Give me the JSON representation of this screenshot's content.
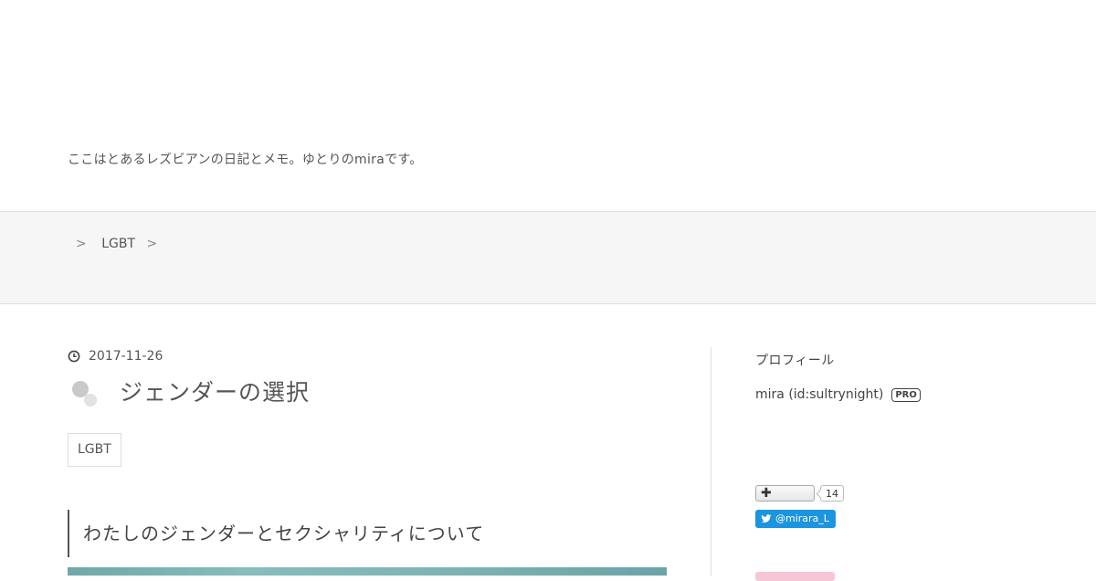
{
  "header": {
    "site_description": "ここはとあるレズビアンの日記とメモ。ゆとりのmiraです。"
  },
  "breadcrumb": {
    "separator_1": ">",
    "category": "LGBT",
    "separator_2": ">"
  },
  "entry": {
    "date": "2017-11-26",
    "title": "ジェンダーの選択",
    "category_tag": "LGBT",
    "section_heading": "わたしのジェンダーとセクシャリティについて"
  },
  "sidebar": {
    "heading": "プロフィール",
    "profile_name": "mira (id:sultrynight)",
    "pro_badge": "PRO",
    "star_count": "14",
    "twitter_handle": "@mirara_L"
  },
  "colors": {
    "twitter_blue": "#1b95e0",
    "crumb_bar_bg": "#f6f6f6",
    "accent_pink": "#f6c6d6"
  },
  "icons": {
    "date": "clock-icon",
    "entry": "circles-icon",
    "star": "plus-icon",
    "twitter": "twitter-bird-icon"
  }
}
